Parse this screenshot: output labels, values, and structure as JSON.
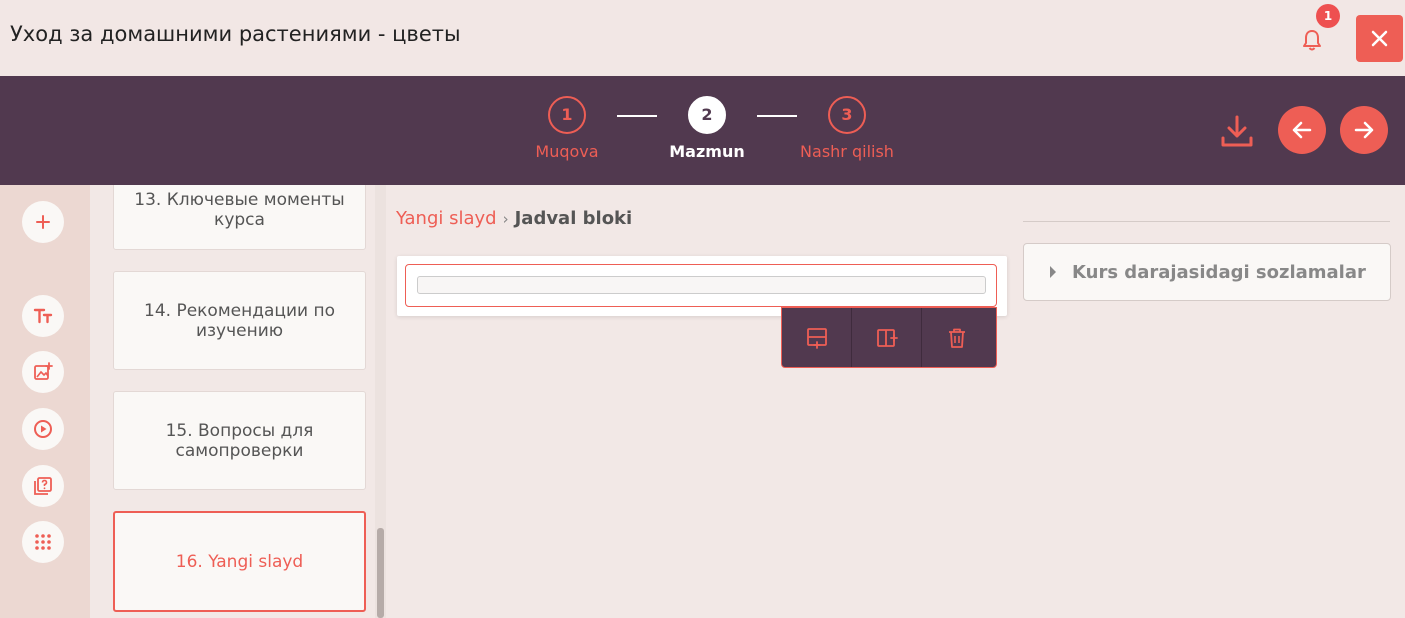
{
  "app": {
    "title": "Уход за домашними растениями - цветы"
  },
  "notifications": {
    "count": "1"
  },
  "stepper": {
    "steps": [
      {
        "number": "1",
        "label": "Muqova"
      },
      {
        "number": "2",
        "label": "Mazmun"
      },
      {
        "number": "3",
        "label": "Nashr qilish"
      }
    ],
    "active_step": 2
  },
  "slides": [
    {
      "label": "13. Ключевые моменты курса"
    },
    {
      "label": "14. Рекомендации по изучению"
    },
    {
      "label": "15. Вопросы для самопроверки"
    },
    {
      "label": "16. Yangi slayd"
    }
  ],
  "breadcrumb": {
    "parent": "Yangi slayd",
    "separator": "›",
    "current": "Jadval bloki"
  },
  "settings": {
    "label": "Kurs darajasidagi sozlamalar"
  },
  "tools": [
    "plus-icon",
    "text-size-icon",
    "image-add-icon",
    "video-play-icon",
    "quiz-icon",
    "grid-dots-icon"
  ],
  "table_toolbar": [
    "add-row-icon",
    "add-column-icon",
    "trash-icon"
  ],
  "colors": {
    "accent": "#ee5e55",
    "header_bg": "#51394f",
    "page_bg": "#f2e8e6",
    "rail_bg": "#ecd8d2"
  }
}
